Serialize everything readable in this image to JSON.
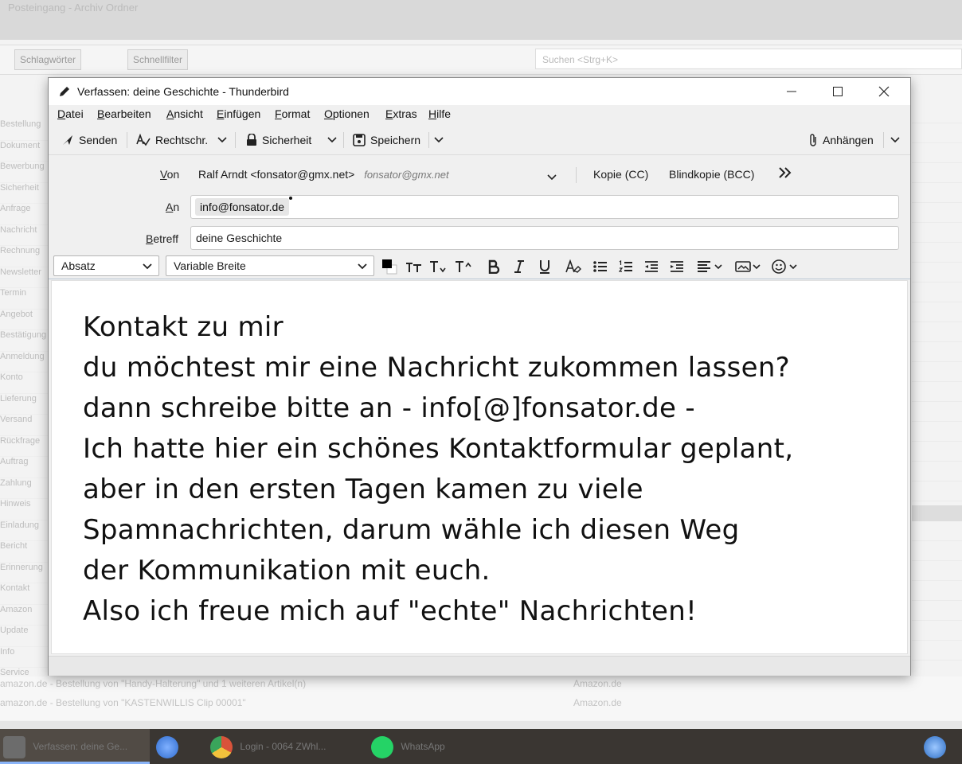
{
  "background": {
    "top_text": "Posteingang - Archiv Ordner",
    "tag_chip": "Schlagwörter",
    "filter_chip": "Schnellfilter",
    "search_placeholder": "Suchen <Strg+K>",
    "list_items": [
      "Bestellung",
      "Dokument",
      "Bewerbung",
      "Sicherheit",
      "Anfrage",
      "Nachricht",
      "Rechnung",
      "Newsletter",
      "Termin",
      "Angebot",
      "Bestätigung",
      "Anmeldung",
      "Konto",
      "Lieferung",
      "Versand",
      "Rückfrage",
      "Auftrag",
      "Zahlung",
      "Hinweis",
      "Einladung",
      "Bericht",
      "Erinnerung",
      "Kontakt",
      "Amazon",
      "Update",
      "Info",
      "Service"
    ],
    "bottom_rows": [
      "amazon.de - Bestellung von \"Handy-Halterung\" und 1 weiteren Artikel(n)",
      "amazon.de - Bestellung von \"KASTENWILLIS Clip 00001\""
    ],
    "bottom_sender": "Amazon.de"
  },
  "taskbar": {
    "items": [
      {
        "label": "Verfassen: deine Ge...",
        "color": "#9a9a9a"
      },
      {
        "label": "",
        "color": "#3d7bd6"
      },
      {
        "label": "Login - 0064 ZWhl...",
        "color": "#d9533a"
      },
      {
        "label": "WhatsApp",
        "color": "#25d366"
      }
    ]
  },
  "window": {
    "title": "Verfassen: deine Geschichte - Thunderbird",
    "menu": [
      "Datei",
      "Bearbeiten",
      "Ansicht",
      "Einfügen",
      "Format",
      "Optionen",
      "Extras",
      "Hilfe"
    ],
    "toolbar": {
      "send": "Senden",
      "spell": "Rechtschr.",
      "security": "Sicherheit",
      "save": "Speichern",
      "attach": "Anhängen"
    },
    "header": {
      "from_label": "Von",
      "from_value": "Ralf Arndt <fonsator@gmx.net>",
      "from_hint": "fonsator@gmx.net",
      "cc": "Kopie (CC)",
      "bcc": "Blindkopie (BCC)",
      "to_label": "An",
      "to_value": "info@fonsator.de",
      "subject_label": "Betreff",
      "subject_value": "deine Geschichte"
    },
    "format": {
      "paragraph": "Absatz",
      "font": "Variable Breite"
    },
    "body_lines": [
      "Kontakt zu mir",
      "du möchtest mir eine Nachricht zukommen lassen?",
      "dann schreibe bitte an - info[@]fonsator.de -",
      "Ich hatte hier ein schönes Kontaktformular geplant,",
      "aber in den ersten Tagen kamen zu viele",
      "Spamnachrichten, darum wähle ich diesen Weg",
      "der Kommunikation mit euch.",
      "Also ich freue mich auf \"echte\" Nachrichten!"
    ]
  }
}
